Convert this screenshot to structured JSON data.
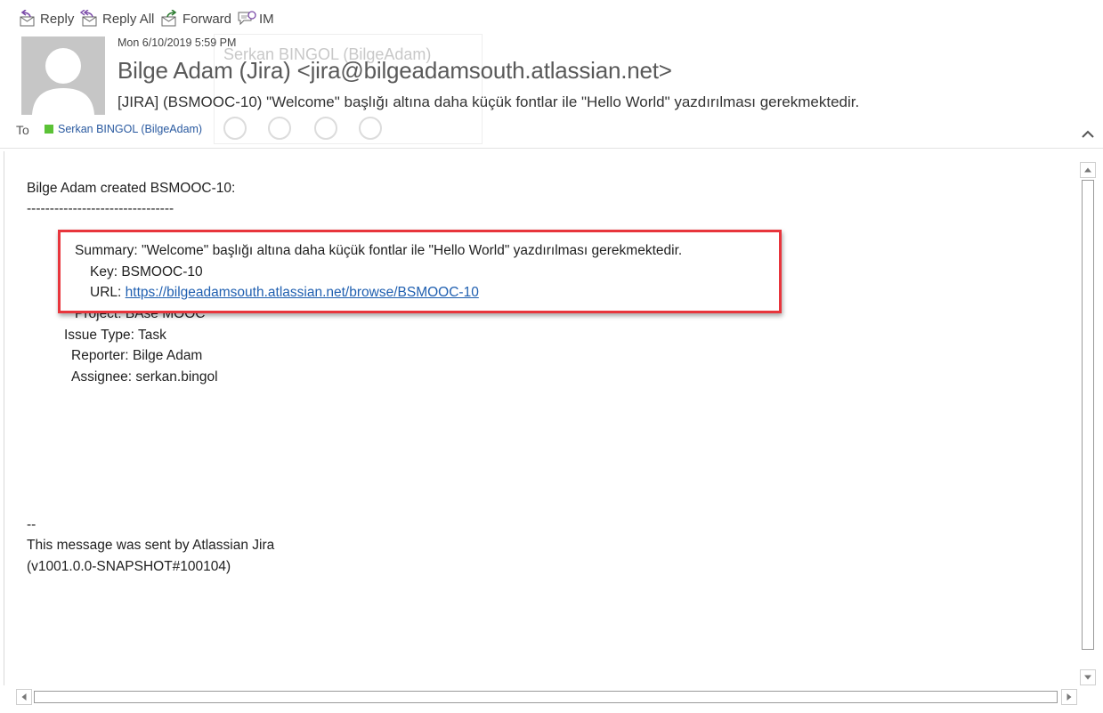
{
  "toolbar": {
    "reply": "Reply",
    "reply_all": "Reply All",
    "forward": "Forward",
    "im": "IM"
  },
  "header": {
    "timestamp": "Mon 6/10/2019 5:59 PM",
    "sender": "Bilge Adam (Jira) <jira@bilgeadamsouth.atlassian.net>",
    "subject": "[JIRA] (BSMOOC-10) \"Welcome\" başlığı altına daha küçük fontlar ile \"Hello World\" yazdırılması gerekmektedir.",
    "to_label": "To",
    "recipient": "Serkan BINGOL (BilgeAdam)",
    "contact_card_name": "Serkan BINGOL (BilgeAdam)",
    "presence_color": "#5bc236"
  },
  "body": {
    "created_line": "Bilge Adam created BSMOOC-10:",
    "separator": "--------------------------------",
    "summary_label": "Summary:",
    "summary_value": "\"Welcome\" başlığı altına daha küçük fontlar ile \"Hello World\" yazdırılması gerekmektedir.",
    "key_label": "Key:",
    "key_value": "BSMOOC-10",
    "url_label": "URL:",
    "url_value": "https://bilgeadamsouth.atlassian.net/browse/BSMOOC-10",
    "project_label": "Project:",
    "project_value": "BAse MOOC",
    "issue_type_label": "Issue Type:",
    "issue_type_value": "Task",
    "reporter_label": "Reporter:",
    "reporter_value": "Bilge Adam",
    "assignee_label": "Assignee:",
    "assignee_value": "serkan.bingol",
    "footer_dashes": "--",
    "footer_line": "This message was sent by Atlassian Jira",
    "footer_version": "(v1001.0.0-SNAPSHOT#100104)"
  },
  "colors": {
    "highlight_border": "#e8353c",
    "link": "#1f5fb0"
  }
}
